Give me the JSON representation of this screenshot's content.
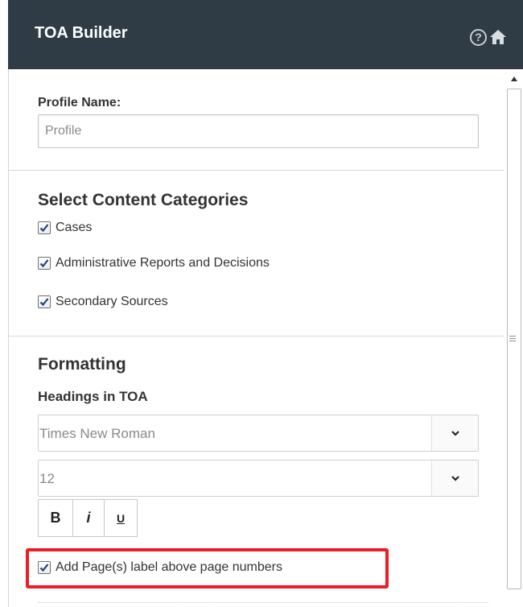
{
  "header": {
    "title": "TOA Builder",
    "help_glyph": "?",
    "background": "#2f3c46"
  },
  "profile": {
    "label": "Profile Name:",
    "placeholder": "Profile"
  },
  "content_categories": {
    "title": "Select Content Categories",
    "items": [
      {
        "label": "Cases",
        "checked": true
      },
      {
        "label": "Administrative Reports and Decisions",
        "checked": true
      },
      {
        "label": "Secondary Sources",
        "checked": true
      }
    ]
  },
  "formatting": {
    "title": "Formatting",
    "subtitle": "Headings in TOA",
    "font_select": {
      "value": "Times New Roman"
    },
    "size_select": {
      "value": "12"
    },
    "buttons": {
      "bold": "B",
      "italic": "i",
      "underline": "U"
    },
    "page_label_option": {
      "label": "Add Page(s) label above page numbers",
      "checked": true
    },
    "highlight_color": "#ee1c24"
  },
  "icons": {
    "help": "help-circle-icon",
    "home": "home-icon",
    "dropdown": "chevron-down-icon",
    "checkbox": "checkmark-icon",
    "scroll_up": "scroll-up-arrow-icon"
  }
}
